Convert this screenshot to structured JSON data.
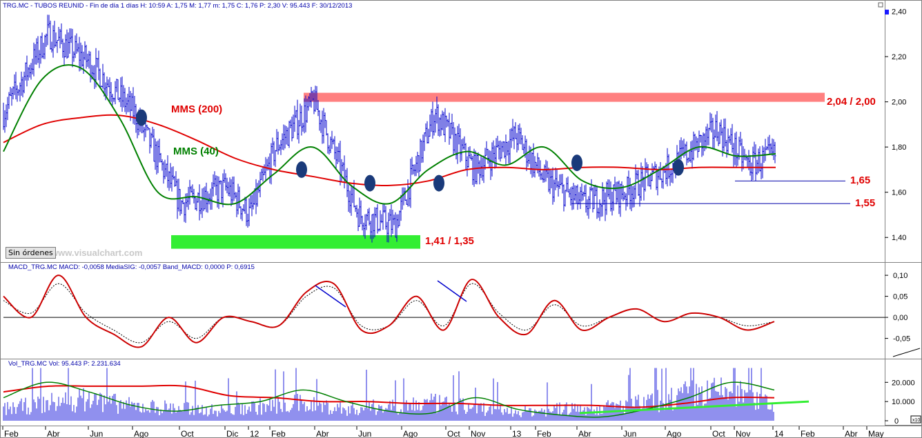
{
  "header": {
    "price_info": "TRG.MC - TUBOS REUNID - Fin de día 1 días  H: 10:59  A: 1,75  M: 1,77  m: 1,75  C: 1,76  P: 2,30  V: 95.443  F: 30/12/2013",
    "watermark": "www.visualchart.com",
    "orders_button": "Sin órdenes"
  },
  "price_panel": {
    "labels": {
      "mms200": "MMS (200)",
      "mms40": "MMS (40)",
      "resistance": "2,04 / 2,00",
      "support_low": "1,41 / 1,35",
      "level_165": "1,65",
      "level_155": "1,55"
    },
    "y_ticks": [
      "2,40",
      "2,20",
      "2,00",
      "1,80",
      "1,60",
      "1,40"
    ]
  },
  "macd_panel": {
    "info": "MACD_TRG.MC  MACD: -0,0058  MediaSIG: -0,0057  Band_MACD: 0,0000  P: 0,6915",
    "y_ticks": [
      "0,10",
      "0,05",
      "0,00",
      "-0,05"
    ]
  },
  "volume_panel": {
    "info": "Vol_TRG.MC  Vol: 95.443  P: 2.231.634",
    "y_ticks": [
      "20.000",
      "10.000",
      "0"
    ],
    "scale_badge": "x10"
  },
  "x_axis": {
    "labels": [
      "Feb",
      "Abr",
      "Jun",
      "Ago",
      "Oct",
      "Dic",
      "12",
      "Feb",
      "Abr",
      "Jun",
      "Ago",
      "Oct",
      "Nov",
      "13",
      "Feb",
      "Abr",
      "Jun",
      "Ago",
      "Oct",
      "Nov",
      "14",
      "Feb",
      "Abr",
      "May"
    ]
  },
  "colors": {
    "price_bars": "#0000cc",
    "mms200": "#e00000",
    "mms40": "#008000",
    "macd": "#cc0000",
    "signal": "#000000",
    "resistance_zone": "#ff8080",
    "support_zone": "#33ee33",
    "crossover_marker": "#1a3a7a",
    "volume_bars": "#2222dd",
    "volume_avg_long": "#e00000",
    "volume_avg_short": "#008000",
    "volume_projection": "#33ee33"
  },
  "chart_data": [
    {
      "type": "line",
      "name": "price",
      "title": "",
      "x_dates": [
        "Feb",
        "Abr",
        "Jun",
        "Ago",
        "Oct",
        "Dic",
        "12",
        "Feb",
        "Abr",
        "Jun",
        "Ago",
        "Oct",
        "Nov",
        "13",
        "Feb",
        "Abr",
        "Jun",
        "Ago",
        "Oct",
        "Nov",
        "14"
      ],
      "price_anchors": [
        1.95,
        2.3,
        2.18,
        1.95,
        1.55,
        1.62,
        1.5,
        1.8,
        2.0,
        1.5,
        1.45,
        1.95,
        1.7,
        1.85,
        1.65,
        1.55,
        1.6,
        1.72,
        1.88,
        1.72,
        1.76
      ],
      "series": [
        {
          "name": "MMS (200)",
          "values": [
            1.82,
            1.9,
            1.93,
            1.94,
            1.9,
            1.83,
            1.75,
            1.7,
            1.67,
            1.64,
            1.63,
            1.65,
            1.7,
            1.71,
            1.7,
            1.71,
            1.71,
            1.7,
            1.71,
            1.71,
            1.71
          ]
        },
        {
          "name": "MMS (40)",
          "values": [
            1.78,
            2.1,
            2.15,
            1.93,
            1.6,
            1.58,
            1.55,
            1.68,
            1.8,
            1.63,
            1.55,
            1.7,
            1.78,
            1.72,
            1.8,
            1.65,
            1.62,
            1.7,
            1.8,
            1.76,
            1.77
          ]
        }
      ],
      "horizontal_levels": [
        {
          "label": "2,04 / 2,00",
          "low": 2.0,
          "high": 2.04
        },
        {
          "label": "1,41 / 1,35",
          "low": 1.35,
          "high": 1.41
        },
        {
          "label": "1,65",
          "value": 1.65
        },
        {
          "label": "1,55",
          "value": 1.55
        }
      ],
      "ylim": [
        1.3,
        2.42
      ],
      "grid": false
    },
    {
      "type": "line",
      "name": "MACD",
      "series": [
        {
          "name": "MACD",
          "values": [
            0.05,
            0.0,
            0.1,
            0.0,
            -0.04,
            -0.07,
            0.0,
            -0.06,
            0.0,
            -0.01,
            -0.02,
            0.06,
            0.08,
            -0.03,
            -0.02,
            0.05,
            -0.03,
            0.09,
            0.0,
            -0.04,
            0.04,
            -0.03,
            0.0,
            0.02,
            -0.01,
            0.01,
            0.0,
            -0.03,
            -0.01
          ]
        },
        {
          "name": "MediaSIG",
          "values": [
            0.04,
            0.01,
            0.08,
            0.01,
            -0.03,
            -0.06,
            -0.01,
            -0.05,
            0.0,
            -0.01,
            -0.02,
            0.05,
            0.07,
            -0.02,
            -0.02,
            0.04,
            -0.02,
            0.08,
            0.01,
            -0.03,
            0.03,
            -0.02,
            0.0,
            0.02,
            -0.01,
            0.01,
            0.0,
            -0.02,
            -0.01
          ]
        }
      ],
      "ylim": [
        -0.09,
        0.11
      ]
    },
    {
      "type": "bar",
      "name": "Volume",
      "series": [
        {
          "name": "Vol",
          "approx_level": [
            8000,
            12000,
            15000,
            10000,
            9000,
            7000,
            10000,
            12000,
            8000,
            10000,
            12000,
            9000,
            6000,
            8000,
            9000,
            12000,
            18000,
            20000,
            10000
          ]
        },
        {
          "name": "Media larga",
          "values": [
            15000,
            18000,
            18000,
            18000,
            18000,
            13000,
            12000,
            10000,
            10000,
            9000,
            9000,
            8000,
            8000,
            8000,
            7000,
            9000,
            12000,
            12000
          ]
        },
        {
          "name": "Media corta",
          "values": [
            12000,
            20000,
            15000,
            8000,
            5000,
            8000,
            10000,
            16000,
            10000,
            5000,
            4000,
            12000,
            6000,
            3000,
            2000,
            6000,
            12000,
            20000,
            16000
          ]
        }
      ],
      "ylim": [
        0,
        28000
      ]
    }
  ]
}
